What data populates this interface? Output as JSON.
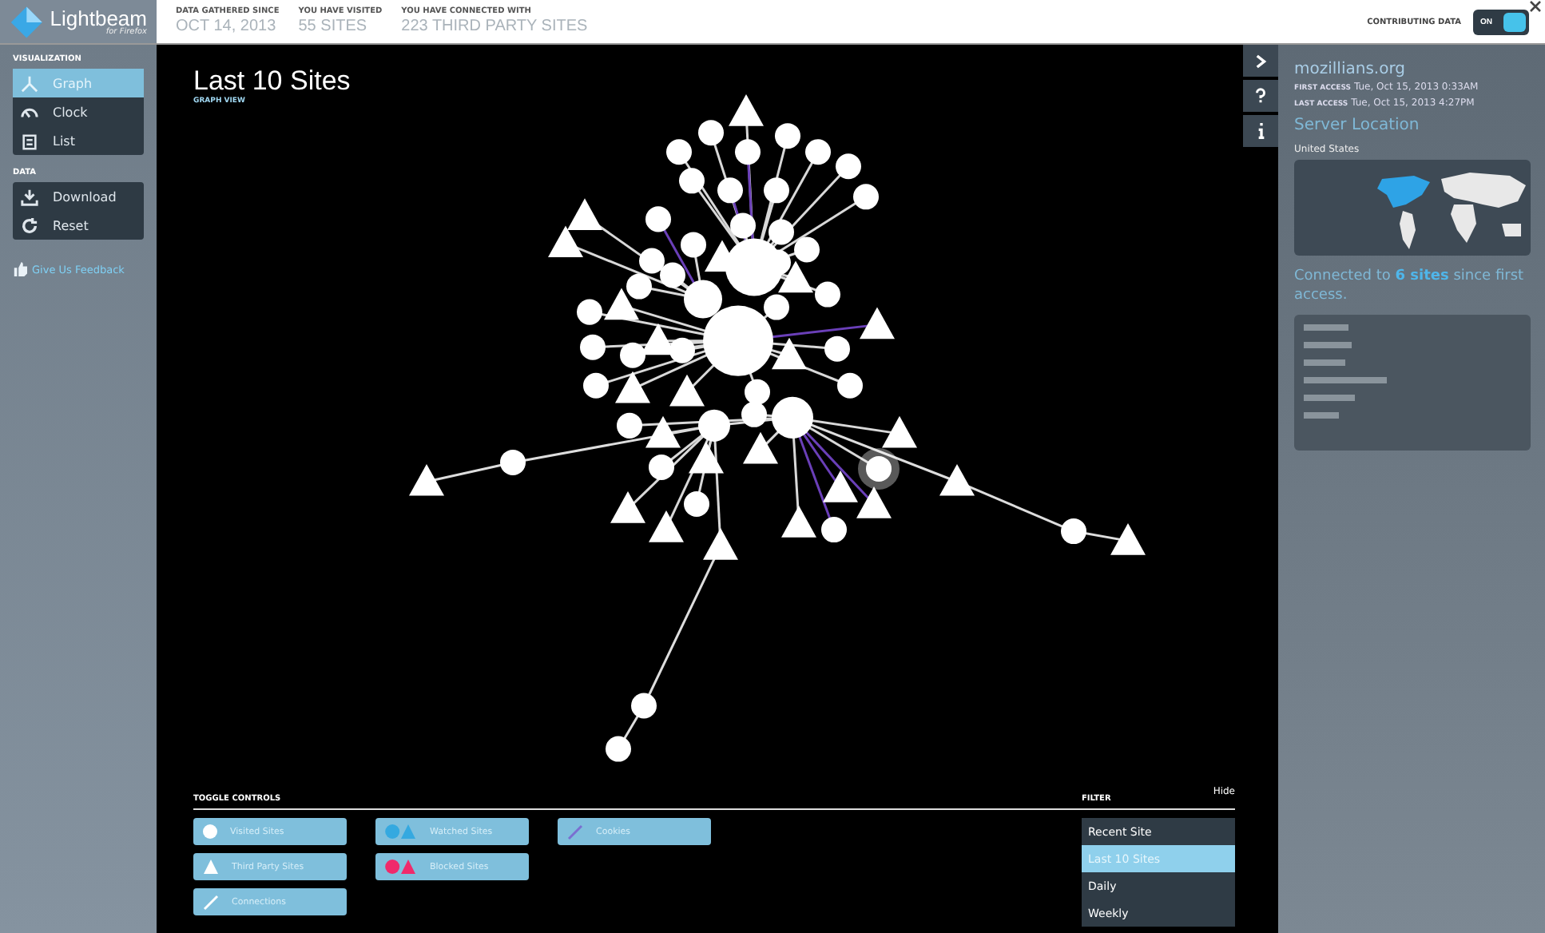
{
  "logo": {
    "name": "Lightbeam",
    "subtitle": "for Firefox"
  },
  "stats": [
    {
      "label": "DATA GATHERED SINCE",
      "value": "OCT 14, 2013"
    },
    {
      "label": "YOU HAVE VISITED",
      "value": "55 SITES"
    },
    {
      "label": "YOU HAVE CONNECTED WITH",
      "value": "223 THIRD PARTY SITES"
    }
  ],
  "contributing": {
    "label": "CONTRIBUTING DATA",
    "state": "ON",
    "on": true
  },
  "sidebar": {
    "sections": [
      {
        "title": "VISUALIZATION",
        "items": [
          {
            "label": "Graph",
            "selected": true
          },
          {
            "label": "Clock",
            "selected": false
          },
          {
            "label": "List",
            "selected": false
          }
        ]
      },
      {
        "title": "DATA",
        "items": [
          {
            "label": "Download",
            "selected": false
          },
          {
            "label": "Reset",
            "selected": false
          }
        ]
      }
    ],
    "feedback": "Give Us Feedback"
  },
  "main": {
    "title": "Last 10 Sites",
    "subtitle": "GRAPH VIEW"
  },
  "toggle_controls": {
    "title": "TOGGLE CONTROLS",
    "items": [
      {
        "label": "Visited Sites",
        "kind": "circle"
      },
      {
        "label": "Watched Sites",
        "kind": "pair",
        "color": "#35a9e0"
      },
      {
        "label": "Cookies",
        "kind": "line",
        "color": "#7a6fd0"
      },
      {
        "label": "Third Party Sites",
        "kind": "triangle"
      },
      {
        "label": "Blocked Sites",
        "kind": "pair",
        "color": "#ef2a6b"
      },
      {
        "label": "Connections",
        "kind": "line",
        "color": "#ffffff"
      }
    ]
  },
  "filter": {
    "title": "FILTER",
    "hide": "Hide",
    "options": [
      {
        "label": "Recent Site",
        "selected": false
      },
      {
        "label": "Last 10 Sites",
        "selected": true
      },
      {
        "label": "Daily",
        "selected": false
      },
      {
        "label": "Weekly",
        "selected": false
      }
    ]
  },
  "panel": {
    "site": "mozillians.org",
    "first_label": "FIRST ACCESS",
    "first": "Tue, Oct 15, 2013 0:33AM",
    "last_label": "LAST ACCESS",
    "last": "Tue, Oct 15, 2013 4:27PM",
    "location_title": "Server Location",
    "country": "United States",
    "connected": "Connected to **6 sites** since first access."
  }
}
